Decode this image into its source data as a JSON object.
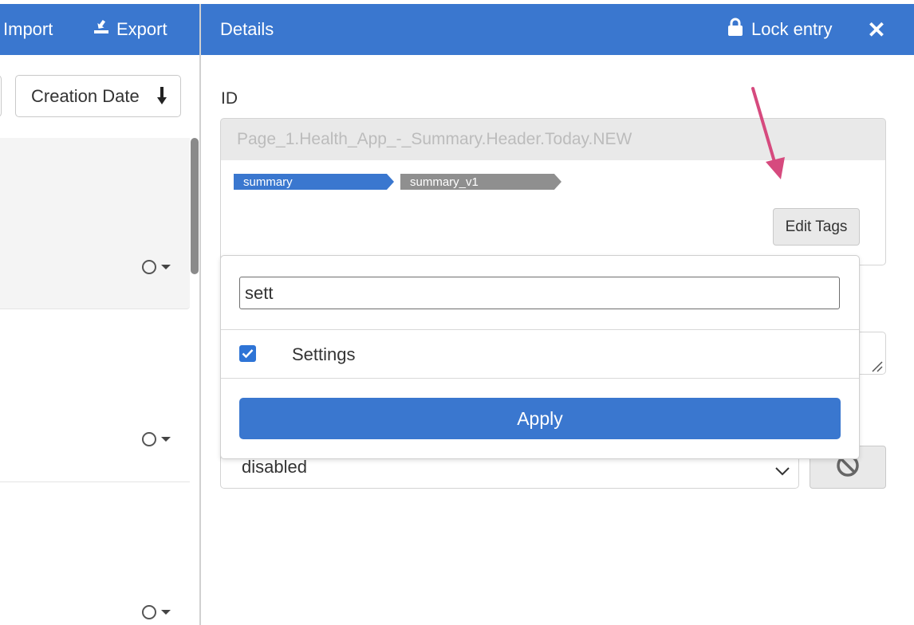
{
  "left_panel": {
    "import_label": "Import",
    "export_label": "Export",
    "sort": {
      "label": "Creation Date",
      "direction_icon": "arrow-down-icon"
    },
    "list": [
      {
        "status_icon": "circle-icon",
        "selected": true
      },
      {
        "status_icon": "circle-icon",
        "selected": false
      },
      {
        "status_icon": "circle-icon",
        "selected": false
      }
    ]
  },
  "details": {
    "title": "Details",
    "lock_label": "Lock entry",
    "close_icon": "close-icon",
    "id_label": "ID",
    "id_value": "Page_1.Health_App_-_Summary.Header.Today.NEW",
    "tags": [
      "summary",
      "summary_v1"
    ],
    "edit_tags_label": "Edit Tags",
    "state_select_value": "disabled"
  },
  "tag_popover": {
    "search_value": "sett",
    "options": [
      {
        "label": "Settings",
        "checked": true
      }
    ],
    "apply_label": "Apply"
  },
  "colors": {
    "header_blue": "#3a77cf",
    "checkbox_blue": "#2e74d6",
    "tag_gray": "#8f8f8f",
    "annotation_arrow": "#d64a7e"
  }
}
